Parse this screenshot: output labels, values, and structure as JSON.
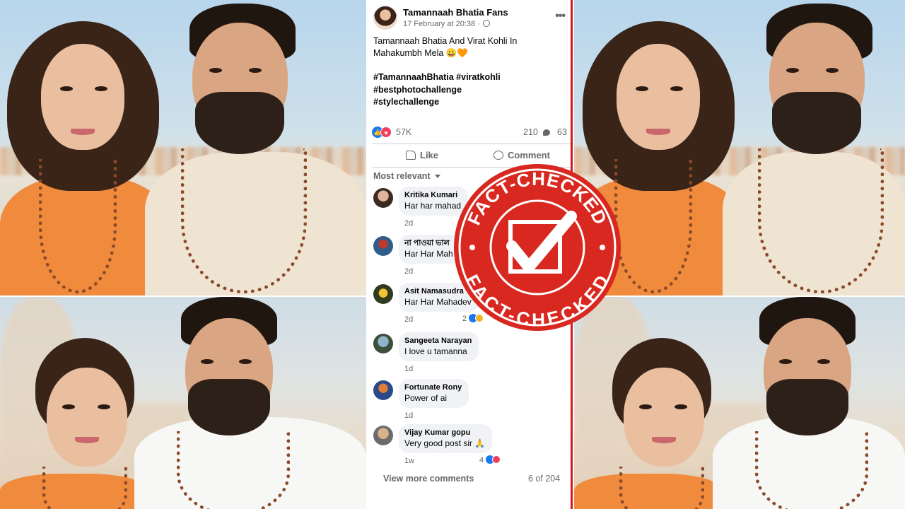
{
  "post": {
    "page_name": "Tamannaah Bhatia Fans",
    "timestamp": "17 February at 20:38 ·",
    "text": "Tamannaah Bhatia And Virat Kohli In Mahakumbh Mela 😀🧡",
    "hashtags": [
      "#TamannaahBhatia #viratkohli",
      "#bestphotochallenge",
      "#stylechallenge"
    ],
    "reaction_count": "57K",
    "comment_count": "210",
    "share_count": "63",
    "like_label": "Like",
    "comment_label": "Comment",
    "sort_label": "Most relevant",
    "view_more_label": "View more comments",
    "page_indicator": "6 of 204"
  },
  "comments": [
    {
      "name": "Kritika Kumari",
      "text": "Har har mahad",
      "time": "2d",
      "reactions": ""
    },
    {
      "name": "না পাওয়া ভাল",
      "text": "Har Har Mah",
      "time": "2d",
      "reactions": ""
    },
    {
      "name": "Asit Namasudra",
      "text": "Har Har Mahadev",
      "time": "2d",
      "reactions": "2"
    },
    {
      "name": "Sangeeta Narayan",
      "text": "I love u tamanna",
      "time": "1d",
      "reactions": ""
    },
    {
      "name": "Fortunate Rony",
      "text": "Power of ai",
      "time": "1d",
      "reactions": ""
    },
    {
      "name": "Vijay Kumar gopu",
      "text": "Very good post sir 🙏",
      "time": "1w",
      "reactions": "4"
    }
  ],
  "stamp": {
    "top_text": "FACT-CHECKED",
    "bottom_text": "FACT-CHECKED",
    "color": "#d8281f"
  },
  "colors": {
    "divider": "#d9161d",
    "facebook_blue": "#1877f2",
    "love_red": "#f33e58"
  }
}
